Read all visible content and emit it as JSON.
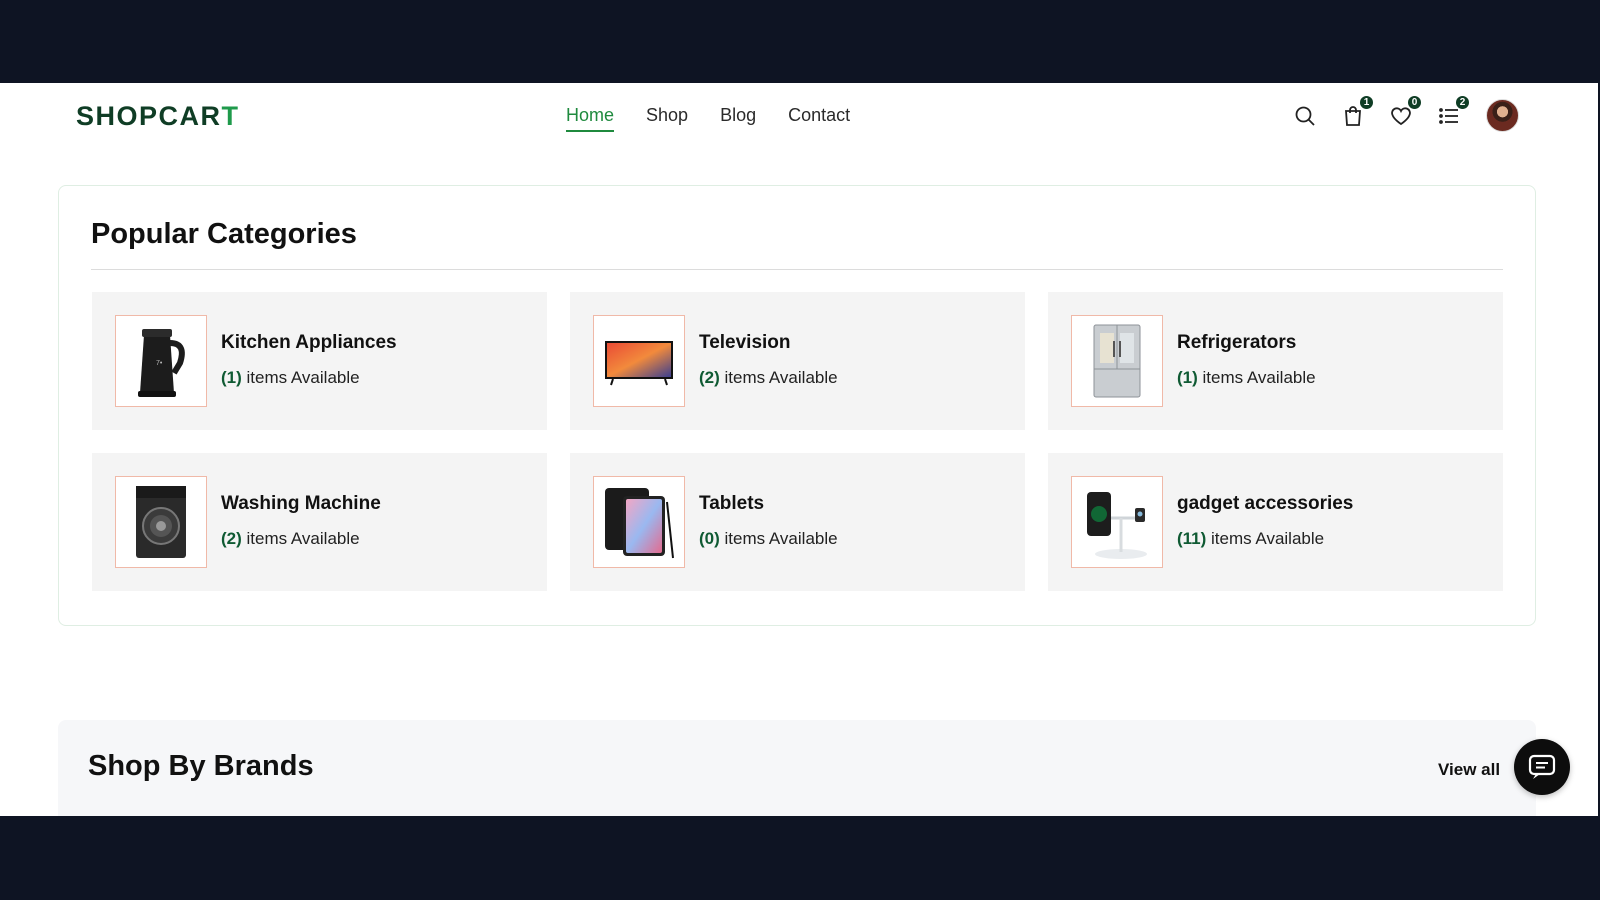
{
  "logo": {
    "text_main": "SHOPCAR",
    "text_accent": "T"
  },
  "nav": [
    {
      "label": "Home",
      "active": true
    },
    {
      "label": "Shop",
      "active": false
    },
    {
      "label": "Blog",
      "active": false
    },
    {
      "label": "Contact",
      "active": false
    }
  ],
  "header_icons": {
    "search": "search-icon",
    "cart": {
      "icon": "cart-icon",
      "count": "1"
    },
    "wishlist": {
      "icon": "heart-icon",
      "count": "0"
    },
    "compare": {
      "icon": "list-icon",
      "count": "2"
    },
    "avatar": "avatar"
  },
  "categories": {
    "title": "Popular Categories",
    "items": [
      {
        "name": "Kitchen Appliances",
        "count": "(1)",
        "suffix": " items Available",
        "thumb": "kettle"
      },
      {
        "name": "Television",
        "count": "(2)",
        "suffix": " items Available",
        "thumb": "tv"
      },
      {
        "name": "Refrigerators",
        "count": "(1)",
        "suffix": " items Available",
        "thumb": "fridge"
      },
      {
        "name": "Washing Machine",
        "count": "(2)",
        "suffix": " items Available",
        "thumb": "washer"
      },
      {
        "name": "Tablets",
        "count": "(0)",
        "suffix": " items Available",
        "thumb": "tablet"
      },
      {
        "name": "gadget accessories",
        "count": "(11)",
        "suffix": " items Available",
        "thumb": "charger"
      }
    ]
  },
  "brands": {
    "title": "Shop By Brands",
    "view_all": "View all"
  },
  "colors": {
    "brand_dark": "#0f3d25",
    "brand_green": "#1f8a3e",
    "frame": "#0e1423"
  }
}
